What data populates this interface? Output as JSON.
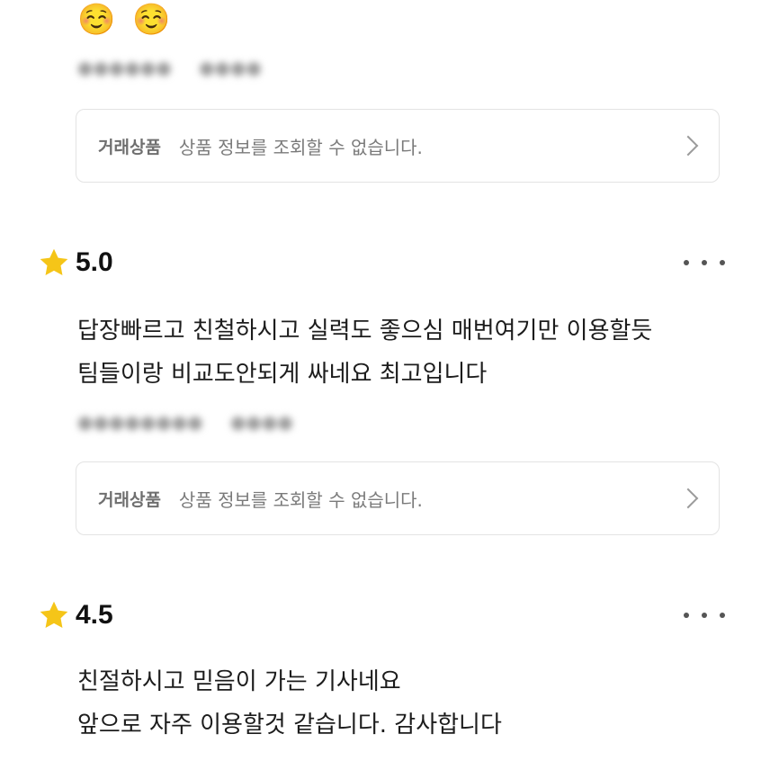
{
  "top_review": {
    "text": "☺️ ☺️",
    "author": "●●●●●●",
    "date": "●●●●"
  },
  "product_card": {
    "label": "거래상품",
    "text": "상품 정보를 조회할 수 없습니다.",
    "chevron_icon": "chevron-right-icon"
  },
  "reviews": [
    {
      "rating": "5.0",
      "star_icon": "star-icon",
      "more_icon": "more-horizontal-icon",
      "lines": [
        "답장빠르고 친철하시고 실력도 좋으심 매번여기만 이용할듯",
        "팀들이랑 비교도안되게 싸네요 최고입니다"
      ],
      "author": "●●●●●●●●",
      "date": "●●●●",
      "product_label": "거래상품",
      "product_text": "상품 정보를 조회할 수 없습니다."
    },
    {
      "rating": "4.5",
      "star_icon": "star-icon",
      "more_icon": "more-horizontal-icon",
      "lines": [
        "친절하시고 믿음이 가는 기사네요",
        "앞으로 자주 이용할것 같습니다. 감사합니다"
      ]
    }
  ],
  "colors": {
    "star": "#F5C518",
    "border": "#E3E3E3",
    "muted_text": "#7A7A7A"
  }
}
